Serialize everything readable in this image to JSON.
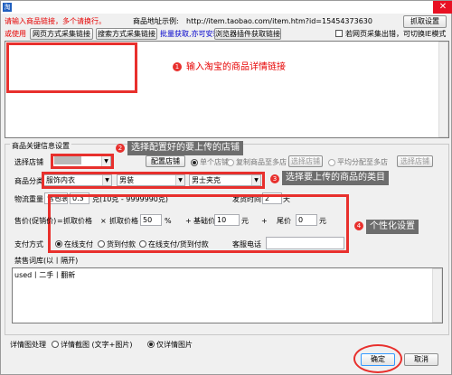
{
  "titlebar": {
    "icon": "app-icon",
    "close": "✕"
  },
  "header": {
    "prompt": "请输入商品链接，多个请换行。",
    "example_label": "商品地址示例:",
    "example_url": "http://item.taobao.com/item.htm?id=15454373630",
    "grab_settings": "抓取设置",
    "or_use": "或使用",
    "btn_web_link": "网页方式采集链接",
    "btn_search_link": "搜索方式采集链接",
    "batch_note": "批量获取,亦可安装",
    "btn_plugin_link": "浏览器插件获取链接",
    "fallback_check": "若网页采集出错，可切换IE模式"
  },
  "annotations": {
    "step1": {
      "num": "1",
      "text": "输入淘宝的商品详情链接"
    },
    "step2": {
      "num": "2",
      "text": "选择配置好的要上传的店铺"
    },
    "step3": {
      "num": "3",
      "text": "选择要上传的商品的类目"
    },
    "step4": {
      "num": "4",
      "text": "个性化设置"
    }
  },
  "settings": {
    "group_title": "商品关键信息设置",
    "store_label": "选择店铺",
    "store_btn": "配置店铺",
    "opt_single": "单个店铺",
    "opt_copy": "复制商品至多店",
    "btn_choose_store1": "选择店铺",
    "opt_avg": "平均分配至多店",
    "btn_choose_store2": "选择店铺",
    "category_label": "商品分类",
    "cat1": "服饰内衣",
    "cat2": "男装",
    "cat3": "男士夹克",
    "weight_label": "物流重量",
    "weight_unit_label": "含包装",
    "weight_value": "0.3",
    "weight_range": "克(10克 - 9999990克)",
    "ship_label": "发货时间",
    "ship_value": "2",
    "ship_unit": "天",
    "price_label": "售价(促销价)",
    "price_eq": "=",
    "price_base": "抓取价格",
    "price_times": "×",
    "price_base2": "抓取价格",
    "price_pct": "50",
    "price_pct_unit": "%",
    "price_plus": "+",
    "price_basic_label": "基础价",
    "price_basic": "10",
    "price_basic_unit": "元",
    "price_plus2": "+",
    "price_tail_label": "尾价",
    "price_tail": "0",
    "price_tail_unit": "元",
    "pay_label": "支付方式",
    "pay_online": "在线支付",
    "pay_cod": "货到付款",
    "pay_both": "在线支付/货到付款",
    "phone_label": "客服电话",
    "phone_value": "",
    "banned_label": "禁售词库(以丨隔开)",
    "banned_value": "used丨二手丨翻新",
    "detail_label": "详情图处理",
    "detail_opt1": "详情截图 (文字+图片)",
    "detail_opt2": "仅详情图片",
    "ok": "确定",
    "cancel": "取消"
  }
}
